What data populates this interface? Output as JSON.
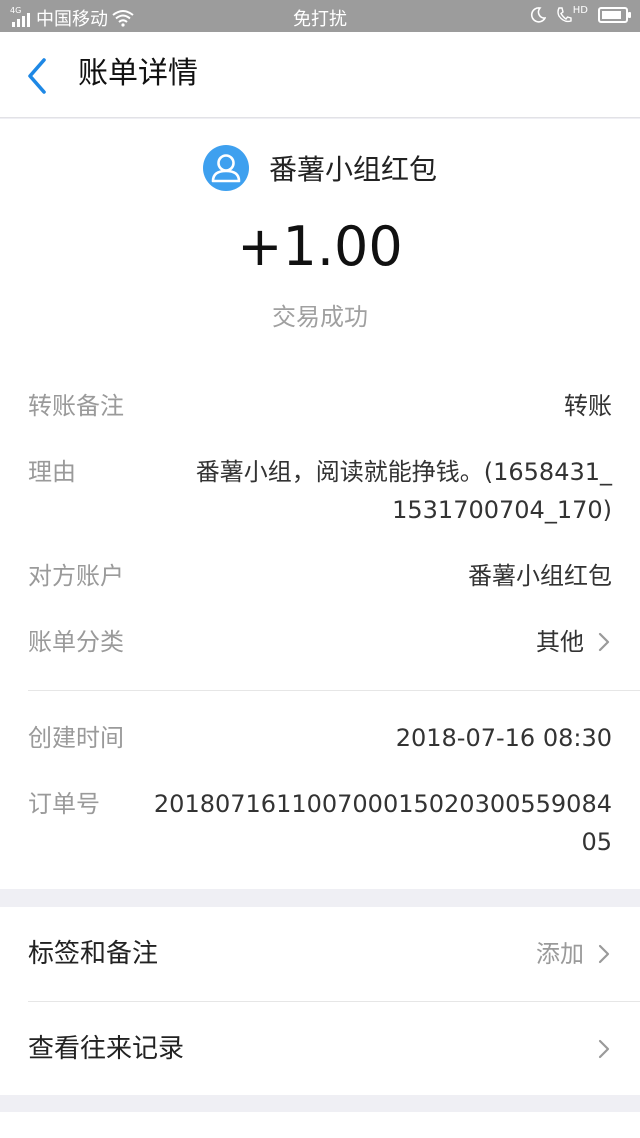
{
  "status_bar": {
    "network": "4G",
    "carrier": "中国移动",
    "mode": "免打扰",
    "hd": "HD",
    "battery_level": 0.85
  },
  "header": {
    "title": "账单详情"
  },
  "transaction": {
    "payer_name": "番薯小组红包",
    "amount": "+1.00",
    "status": "交易成功"
  },
  "details": {
    "remark_label": "转账备注",
    "remark_value": "转账",
    "reason_label": "理由",
    "reason_line1": "番薯小组，阅读就能挣钱。(1658431_",
    "reason_line2": "1531700704_170)",
    "account_label": "对方账户",
    "account_value": "番薯小组红包",
    "category_label": "账单分类",
    "category_value": "其他",
    "created_label": "创建时间",
    "created_value": "2018-07-16 08:30",
    "order_label": "订单号",
    "order_line1": "2018071611007000150203005590​84",
    "order_line2": "05"
  },
  "actions": {
    "tags_label": "标签和备注",
    "tags_hint": "添加",
    "history_label": "查看往来记录"
  },
  "colors": {
    "accent": "#1e88e5",
    "avatar": "#3ea0ef",
    "status_bar": "#9c9c9c"
  }
}
